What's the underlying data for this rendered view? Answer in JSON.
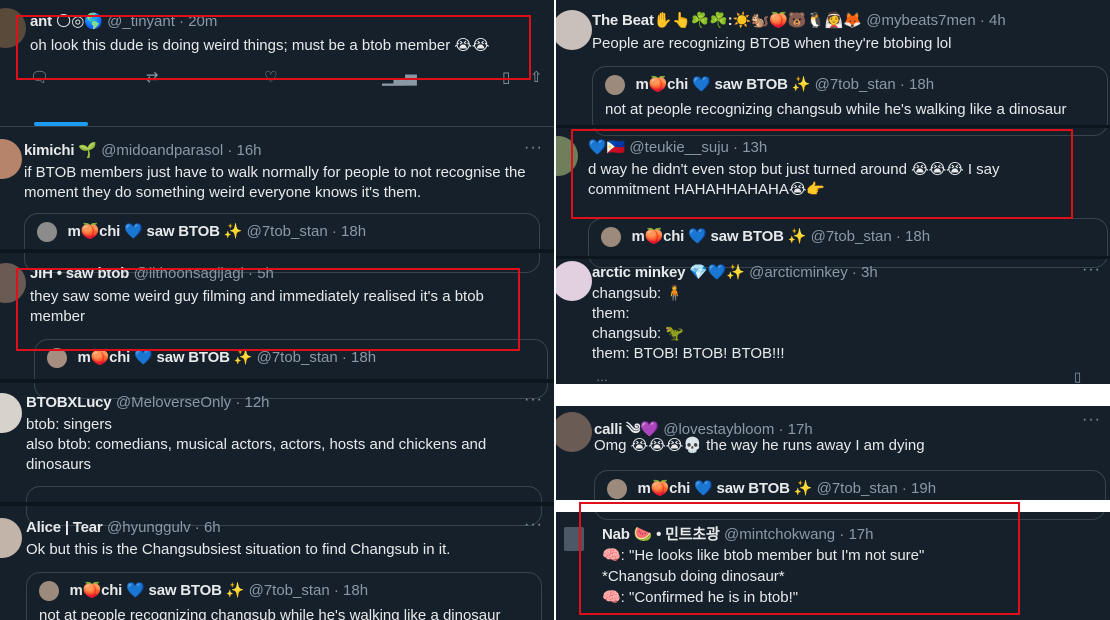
{
  "left": {
    "t1": {
      "name": "ant 🌕◎🌎",
      "handle": "@_tinyant · 20m",
      "text": "oh look this dude is doing weird things; must be a btob member 😭😭"
    },
    "t2": {
      "name": "kimichi 🌱",
      "handle": "@midoandparasol · 16h",
      "text": "if BTOB members just have to walk normally for people to not recognise the moment they do something weird everyone knows it's them.",
      "quote": {
        "name": "m🍑chi 💙 saw BTOB ✨",
        "handle": "@7tob_stan · 18h"
      }
    },
    "t3": {
      "name": "JIH • saw btob",
      "handle": "@ilthoonsagijagi · 5h",
      "text": "they saw some weird guy filming and immediately realised it's a btob member",
      "quote": {
        "name": "m🍑chi 💙 saw BTOB ✨",
        "handle": "@7tob_stan · 18h"
      }
    },
    "t4": {
      "name": "BTOBXLucy",
      "handle": "@MeloverseOnly · 12h",
      "text": "btob: singers\nalso btob: comedians, musical actors, actors, hosts and chickens and dinosaurs"
    },
    "t5": {
      "name": "Alice | Tear",
      "handle": "@hyunggulv · 6h",
      "text": "Ok but this is the Changsubsiest situation to find Changsub in it.",
      "quote": {
        "name": "m🍑chi 💙 saw BTOB ✨",
        "handle": "@7tob_stan · 18h",
        "text": "not at people recognizing changsub while he's walking like a dinosaur"
      }
    }
  },
  "right": {
    "t1": {
      "name": "The Beat✋👆☘️☘️:☀️🐿️🍑🐻🐧👰🦊",
      "handle": "@mybeats7men · 4h",
      "text": "People are recognizing BTOB when they're btobing lol",
      "quote": {
        "name": "m🍑chi 💙 saw BTOB ✨",
        "handle": "@7tob_stan · 18h",
        "text": "not at people recognizing changsub while he's walking like a dinosaur"
      }
    },
    "t2": {
      "name": "💙🇵🇭",
      "handle": "@teukie__suju · 13h",
      "text": "d way he didn't even stop but just turned around 😭😭😭 I say commitment HAHAHHAHAHA😭👉",
      "quote": {
        "name": "m🍑chi 💙 saw BTOB ✨",
        "handle": "@7tob_stan · 18h"
      }
    },
    "t3": {
      "name": "arctic minkey 💎💙✨",
      "handle": "@arcticminkey · 3h",
      "text": "changsub: 🧍\nthem:\nchangsub: 🦖\nthem: BTOB! BTOB! BTOB!!!"
    },
    "t4": {
      "name": "calli ༄💜",
      "handle": "@lovestaybloom · 17h",
      "text": "Omg 😭😭😭💀 the way he runs away I am dying",
      "quote": {
        "name": "m🍑chi 💙 saw BTOB ✨",
        "handle": "@7tob_stan · 19h"
      }
    },
    "t5": {
      "name": "Nab 🍉 • 민트초광",
      "handle": "@mintchokwang · 17h",
      "text": "🧠: \"He looks like btob member but I'm not sure\"\n*Changsub doing dinosaur*\n🧠: \"Confirmed he is in btob!\""
    }
  },
  "icons": [
    "reply-icon",
    "retweet-icon",
    "like-icon",
    "views-icon",
    "share-icon",
    "more-icon"
  ],
  "colors": {
    "background": "#15202b",
    "highlight": "#e0101a",
    "accent": "#1d9bf0"
  }
}
